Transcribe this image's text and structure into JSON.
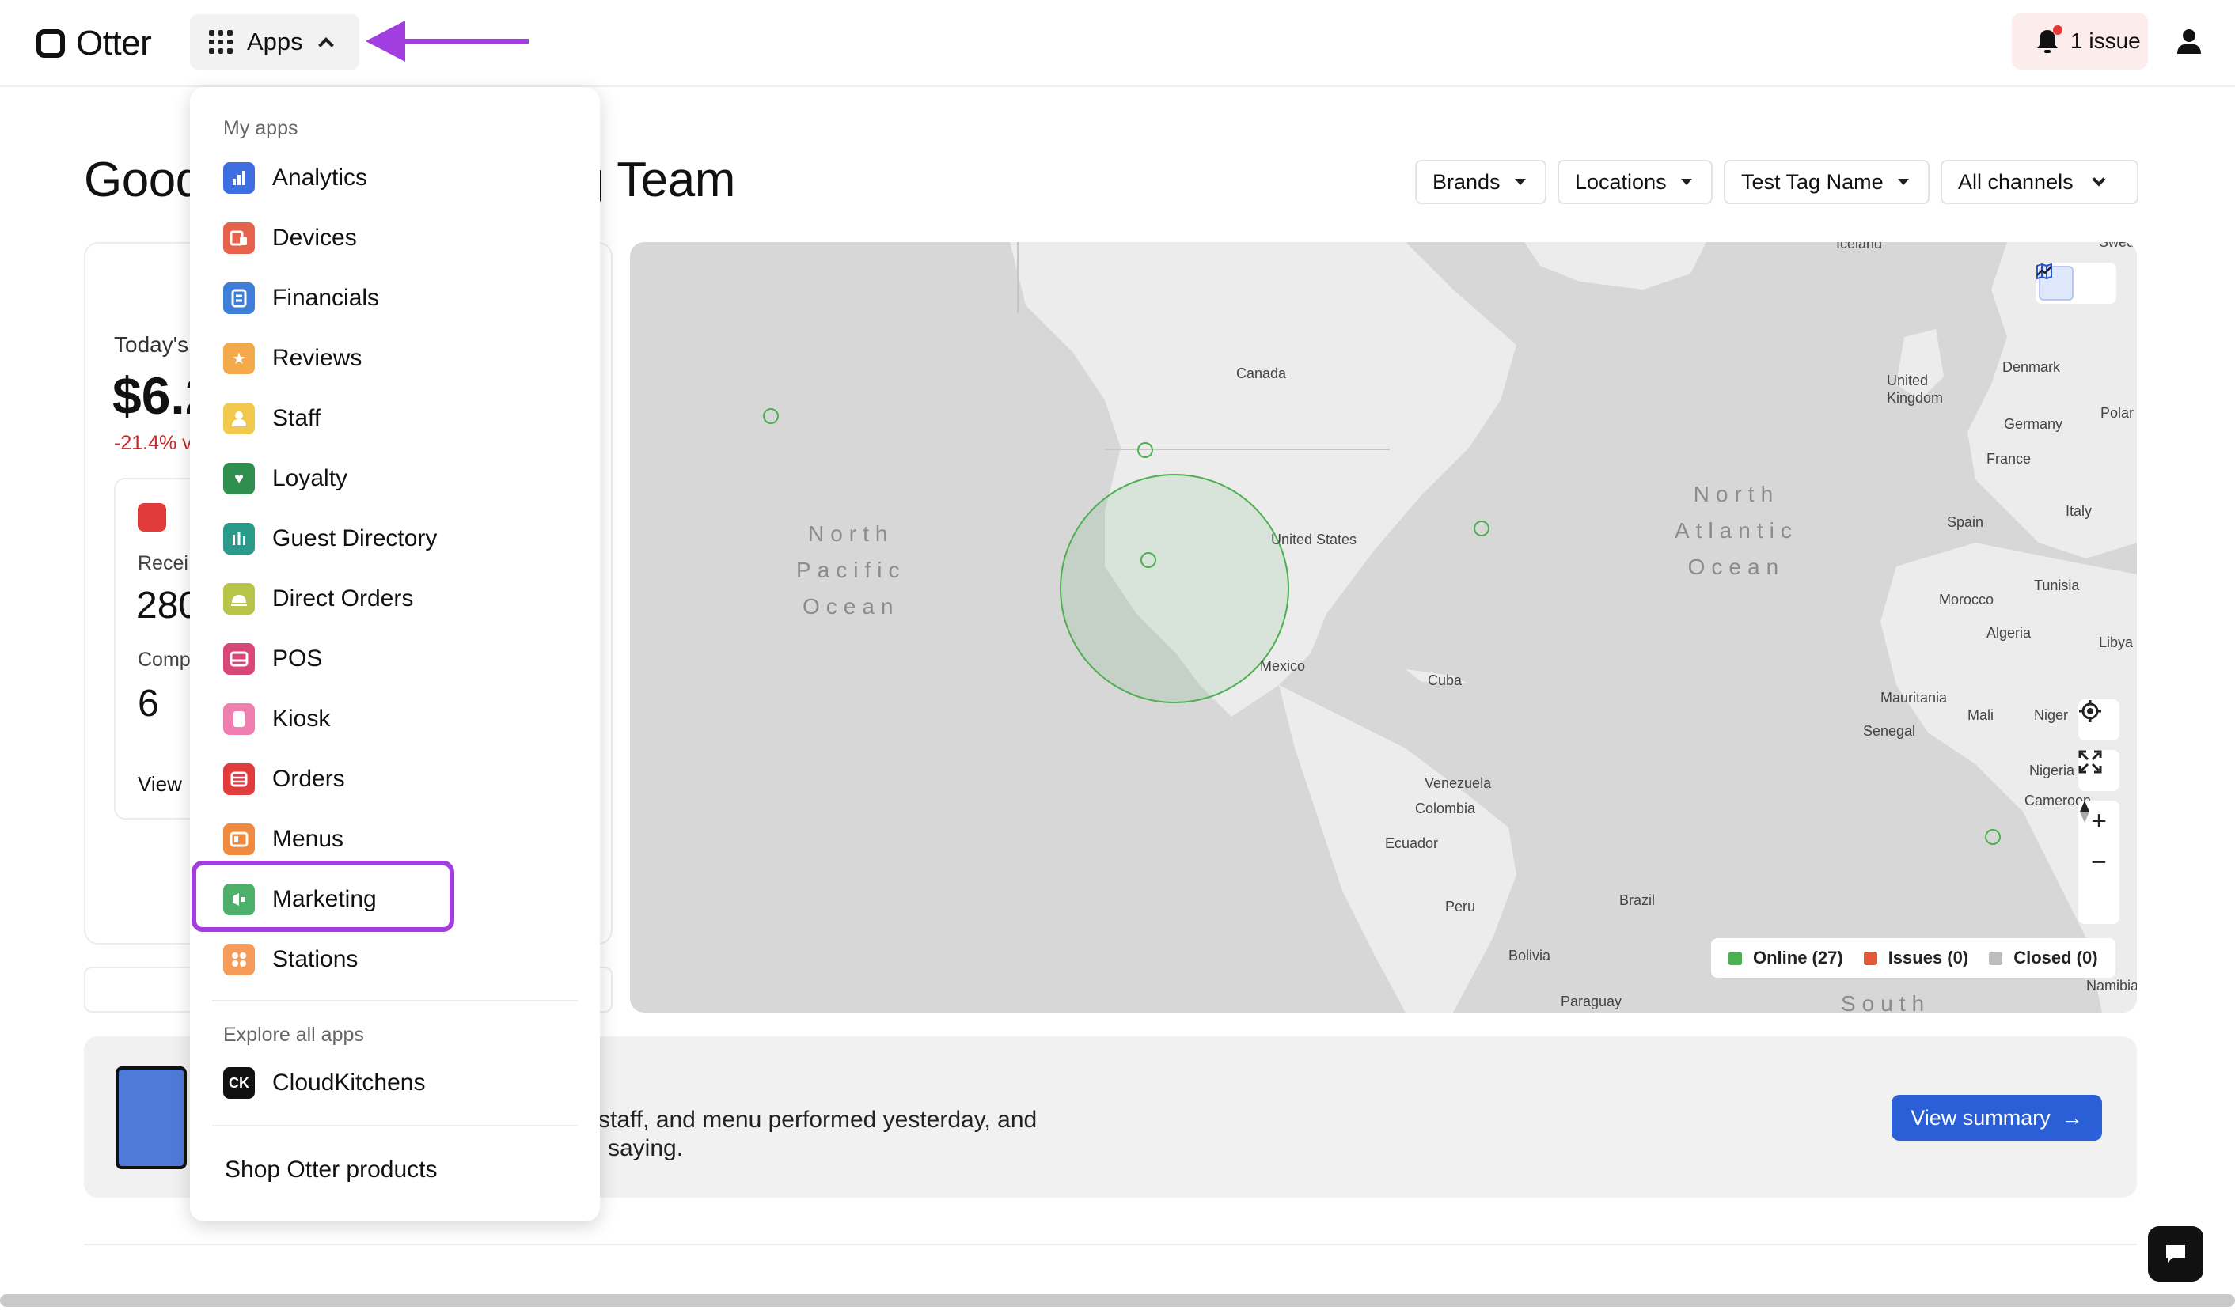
{
  "header": {
    "brand": "Otter",
    "apps_label": "Apps",
    "issues_label": "1 issue"
  },
  "greeting": "Good morning, Learning Team",
  "filters": [
    "Brands",
    "Locations",
    "Test Tag Name",
    "All channels"
  ],
  "stats": {
    "today_label": "Today's",
    "today_value": "$6.2",
    "today_change": "-21.4% v",
    "received_label": "Recei",
    "received_value": "280",
    "completed_label": "Comp",
    "completed_value": "6",
    "view_label": "View"
  },
  "apps_menu": {
    "my_apps_label": "My apps",
    "items": [
      {
        "label": "Analytics",
        "icon": "analytics-icon",
        "color": "#3d6fe0"
      },
      {
        "label": "Devices",
        "icon": "devices-icon",
        "color": "#e5634a"
      },
      {
        "label": "Financials",
        "icon": "financials-icon",
        "color": "#3d7fd8"
      },
      {
        "label": "Reviews",
        "icon": "reviews-icon",
        "color": "#f4a94b"
      },
      {
        "label": "Staff",
        "icon": "staff-icon",
        "color": "#f2c94c"
      },
      {
        "label": "Loyalty",
        "icon": "loyalty-icon",
        "color": "#2f8f4e"
      },
      {
        "label": "Guest Directory",
        "icon": "guest-directory-icon",
        "color": "#2a9a8a"
      },
      {
        "label": "Direct Orders",
        "icon": "direct-orders-icon",
        "color": "#b9c44a"
      },
      {
        "label": "POS",
        "icon": "pos-icon",
        "color": "#d9477a"
      },
      {
        "label": "Kiosk",
        "icon": "kiosk-icon",
        "color": "#ef7fb0"
      },
      {
        "label": "Orders",
        "icon": "orders-icon",
        "color": "#e13b3b"
      },
      {
        "label": "Menus",
        "icon": "menus-icon",
        "color": "#f08a3e"
      },
      {
        "label": "Marketing",
        "icon": "marketing-icon",
        "color": "#4caf6a"
      },
      {
        "label": "Stations",
        "icon": "stations-icon",
        "color": "#f59c5b"
      }
    ],
    "explore_label": "Explore all apps",
    "explore_items": [
      {
        "label": "CloudKitchens",
        "icon_text": "CK",
        "color": "#111111"
      }
    ],
    "shop_label": "Shop Otter products"
  },
  "map": {
    "labels": [
      "Canada",
      "United States",
      "Mexico",
      "Cuba",
      "Venezuela",
      "Colombia",
      "Ecuador",
      "Peru",
      "Brazil",
      "Bolivia",
      "Paraguay",
      "Iceland",
      "United Kingdom",
      "Denmark",
      "Germany",
      "Polar",
      "France",
      "Italy",
      "Spain",
      "Tunisia",
      "Morocco",
      "Algeria",
      "Libya",
      "Mauritania",
      "Mali",
      "Niger",
      "Senegal",
      "Nigeria",
      "Cameroon",
      "Namibia",
      "Swed"
    ],
    "oceans": [
      "North Pacific Ocean",
      "North Atlantic Ocean",
      "South"
    ],
    "legend": [
      {
        "label": "Online (27)",
        "color": "#4caf50"
      },
      {
        "label": "Issues (0)",
        "color": "#e15b3b"
      },
      {
        "label": "Closed (0)",
        "color": "#bdbdbd"
      }
    ]
  },
  "banner": {
    "text_line1": "staff, and menu performed yesterday, and",
    "text_line2": "saying.",
    "button_label": "View summary"
  },
  "colors": {
    "accent_annotation": "#a23ee0",
    "primary": "#2a5fd8"
  }
}
